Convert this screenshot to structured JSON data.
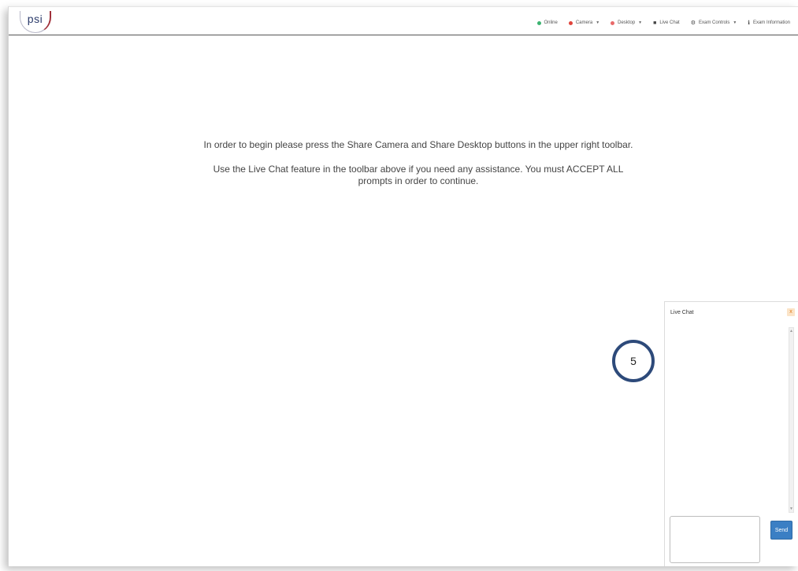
{
  "header": {
    "logo_text": "psi"
  },
  "toolbar": {
    "items": [
      {
        "label": "Online",
        "icon": "status-dot-icon",
        "color": "#3cb371"
      },
      {
        "label": "Camera",
        "icon": "camera-icon",
        "color": "#e0443c"
      },
      {
        "label": "Desktop",
        "icon": "desktop-icon",
        "color": "#e86a6a"
      },
      {
        "label": "Live Chat",
        "icon": "chat-icon"
      },
      {
        "label": "Exam Controls",
        "icon": "gear-icon"
      },
      {
        "label": "Exam Information",
        "icon": "info-icon"
      }
    ]
  },
  "main": {
    "instruction_1": "In order to begin please press the Share Camera and Share Desktop buttons in the upper right toolbar.",
    "instruction_2": "Use the Live Chat feature in the toolbar above if you need any assistance. You must ACCEPT ALL prompts in order to continue."
  },
  "annotation": {
    "number": "5"
  },
  "chat": {
    "title": "Live Chat",
    "close_label": "x",
    "send_label": "Send",
    "input_value": ""
  },
  "colors": {
    "accent": "#3b7fc4",
    "badge_border": "#2d4a7a",
    "online": "#3cb371",
    "camera": "#e0443c",
    "desktop": "#e86a6a",
    "close": "#e07b1a"
  }
}
